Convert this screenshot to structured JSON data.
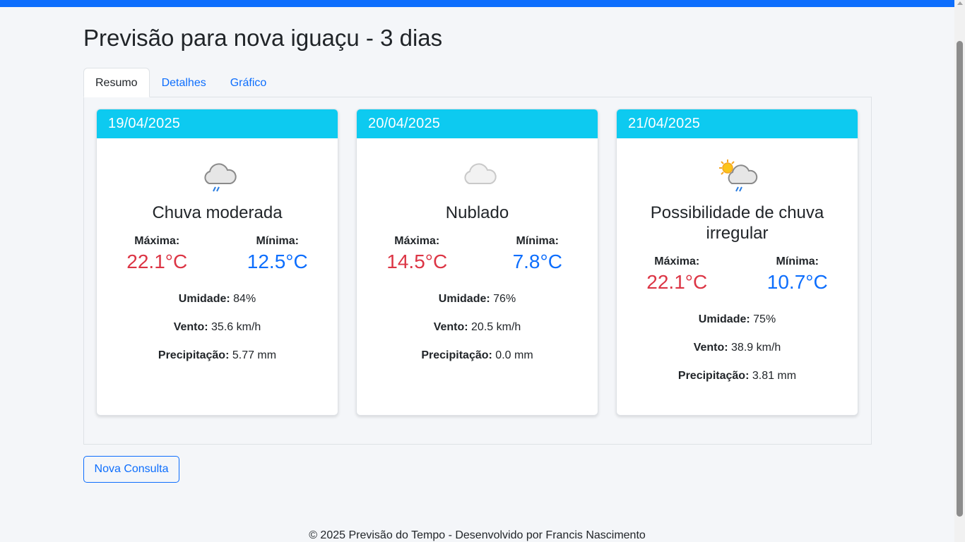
{
  "page": {
    "title": "Previsão para nova iguaçu - 3 dias"
  },
  "tabs": [
    {
      "label": "Resumo",
      "active": true
    },
    {
      "label": "Detalhes",
      "active": false
    },
    {
      "label": "Gráfico",
      "active": false
    }
  ],
  "labels": {
    "max": "Máxima:",
    "min": "Mínima:",
    "humidity": "Umidade:",
    "wind": "Vento:",
    "precipitation": "Precipitação:"
  },
  "days": [
    {
      "date": "19/04/2025",
      "icon": "rain-cloud-icon",
      "condition": "Chuva moderada",
      "max": "22.1°C",
      "min": "12.5°C",
      "humidity": "84%",
      "wind": "35.6 km/h",
      "precipitation": "5.77 mm"
    },
    {
      "date": "20/04/2025",
      "icon": "cloud-icon",
      "condition": "Nublado",
      "max": "14.5°C",
      "min": "7.8°C",
      "humidity": "76%",
      "wind": "20.5 km/h",
      "precipitation": "0.0 mm"
    },
    {
      "date": "21/04/2025",
      "icon": "sun-cloud-rain-icon",
      "condition": "Possibilidade de chuva irregular",
      "max": "22.1°C",
      "min": "10.7°C",
      "humidity": "75%",
      "wind": "38.9 km/h",
      "precipitation": "3.81 mm"
    }
  ],
  "actions": {
    "new_query": "Nova Consulta"
  },
  "footer": {
    "text": "© 2025 Previsão do Tempo - Desenvolvido por Francis Nascimento"
  },
  "colors": {
    "primary": "#0d6efd",
    "info": "#0dcaf0",
    "danger": "#dc3545"
  }
}
